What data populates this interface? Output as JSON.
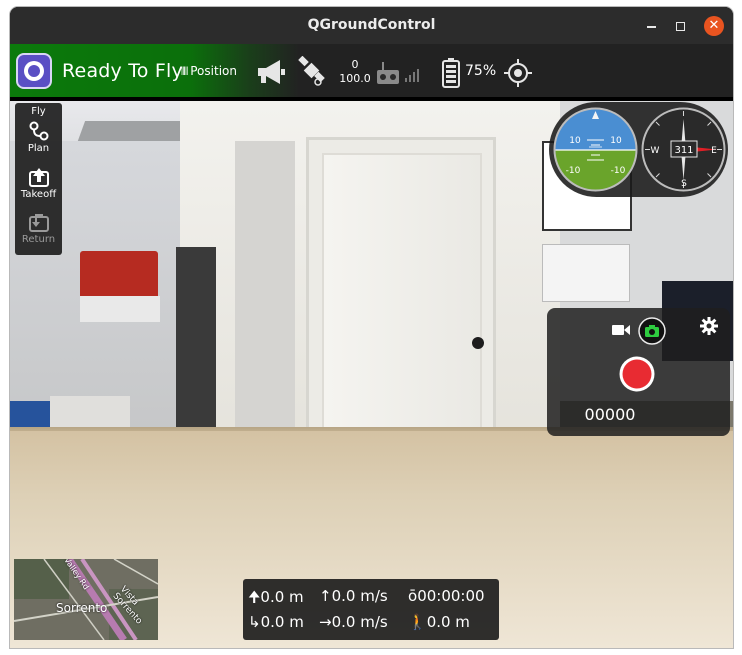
{
  "window": {
    "title": "QGroundControl"
  },
  "toolbar": {
    "status": "Ready To Fly",
    "flight_mode": "Position",
    "gps_count": "0",
    "gps_hdop": "100.0",
    "battery_percent": "75%"
  },
  "fly_tools": {
    "title": "Fly",
    "items": [
      {
        "label": "Plan",
        "icon": "plan-icon",
        "enabled": true
      },
      {
        "label": "Takeoff",
        "icon": "takeoff-icon",
        "enabled": true
      },
      {
        "label": "Return",
        "icon": "return-icon",
        "enabled": false
      }
    ]
  },
  "instruments": {
    "attitude_pitch_labels": [
      "10",
      "10",
      "-10",
      "-10"
    ],
    "heading": "311",
    "compass_letters": {
      "west": "W",
      "east": "E",
      "south": "S"
    }
  },
  "camera": {
    "counter": "00000"
  },
  "map": {
    "labels": [
      "Sorrento",
      "Vista Sorrento",
      "Valley Rd"
    ]
  },
  "telemetry": {
    "altitude_relative": "0.0 m",
    "vertical_speed": "0.0 m/s",
    "flight_time": "00:00:00",
    "distance_home": "0.0 m",
    "ground_speed": "0.0 m/s",
    "distance_ground": "0.0 m"
  },
  "colors": {
    "ready_green": "#0b7a0b",
    "record_red": "#e82b32",
    "camera_active": "#2ecc40",
    "close_button": "#e95420",
    "logo_purple": "#5a4fc4"
  }
}
